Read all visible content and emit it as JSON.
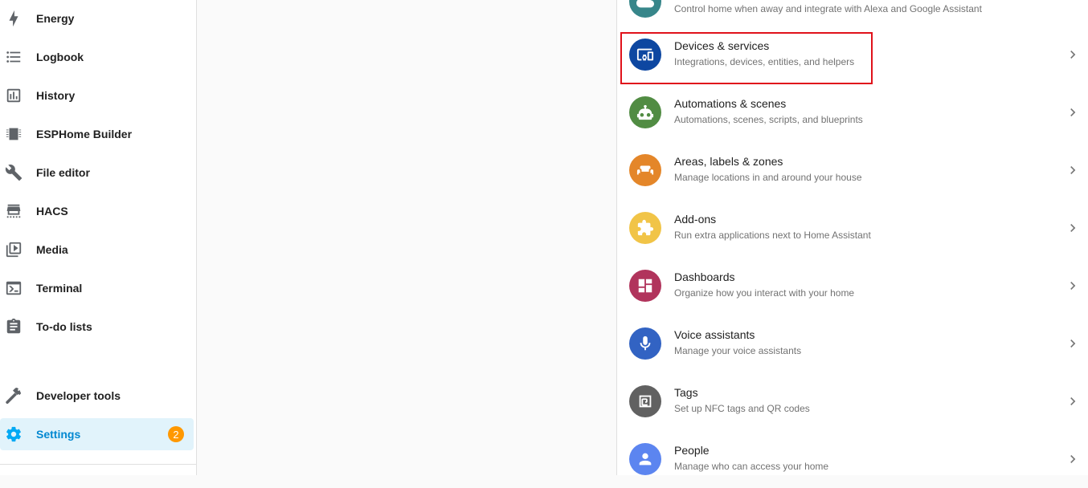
{
  "sidebar": {
    "items": [
      {
        "label": "Energy",
        "icon": "lightning-bolt-icon"
      },
      {
        "label": "Logbook",
        "icon": "format-list-bulleted-icon"
      },
      {
        "label": "History",
        "icon": "chart-box-icon"
      },
      {
        "label": "ESPHome Builder",
        "icon": "chip-icon"
      },
      {
        "label": "File editor",
        "icon": "wrench-icon"
      },
      {
        "label": "HACS",
        "icon": "hacs-store-icon"
      },
      {
        "label": "Media",
        "icon": "play-box-multiple-icon"
      },
      {
        "label": "Terminal",
        "icon": "console-icon"
      },
      {
        "label": "To-do lists",
        "icon": "clipboard-list-icon"
      }
    ],
    "developer_tools": {
      "label": "Developer tools",
      "icon": "hammer-icon"
    },
    "settings": {
      "label": "Settings",
      "icon": "cog-icon",
      "badge": "2",
      "active": true
    },
    "active_color": "#03a9f4"
  },
  "settings_list": {
    "items": [
      {
        "title": "",
        "description": "Control home when away and integrate with Alexa and Google Assistant",
        "icon": "cloud-lock-icon",
        "color": "#37868a"
      },
      {
        "title": "Devices & services",
        "description": "Integrations, devices, entities, and helpers",
        "icon": "devices-icon",
        "color": "#0d47a1",
        "highlighted": true
      },
      {
        "title": "Automations & scenes",
        "description": "Automations, scenes, scripts, and blueprints",
        "icon": "robot-icon",
        "color": "#518c43"
      },
      {
        "title": "Areas, labels & zones",
        "description": "Manage locations in and around your house",
        "icon": "sofa-icon",
        "color": "#e48629"
      },
      {
        "title": "Add-ons",
        "description": "Run extra applications next to Home Assistant",
        "icon": "puzzle-icon",
        "color": "#f1c447"
      },
      {
        "title": "Dashboards",
        "description": "Organize how you interact with your home",
        "icon": "view-dashboard-icon",
        "color": "#b1345c"
      },
      {
        "title": "Voice assistants",
        "description": "Manage your voice assistants",
        "icon": "microphone-icon",
        "color": "#3263c3"
      },
      {
        "title": "Tags",
        "description": "Set up NFC tags and QR codes",
        "icon": "nfc-icon",
        "color": "#616161"
      },
      {
        "title": "People",
        "description": "Manage who can access your home",
        "icon": "account-icon",
        "color": "#5c85f0"
      }
    ]
  },
  "highlight_color": "#e0121b"
}
